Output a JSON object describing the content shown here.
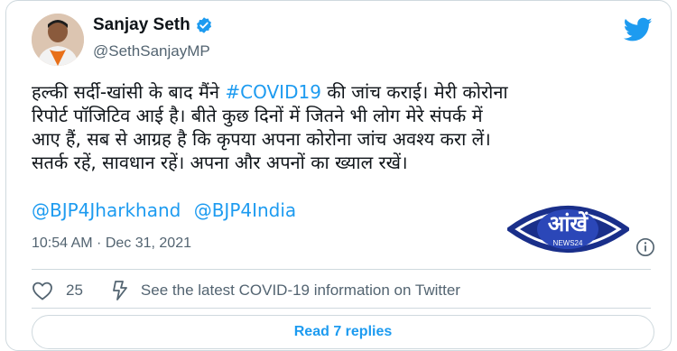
{
  "user": {
    "display_name": "Sanjay Seth",
    "handle": "@SethSanjayMP",
    "verified": true,
    "avatar_icon": "user-avatar"
  },
  "tweet": {
    "line1_before_link": "हल्की सर्दी-खांसी के बाद मैंने ",
    "hashtag": "#COVID19",
    "line1_after_link": " की जांच कराई। मेरी कोरोना",
    "line2": "रिपोर्ट पॉजिटिव आई है। बीते कुछ दिनों में जितने भी लोग मेरे संपर्क में",
    "line3": "आए हैं, सब से आग्रह है कि कृपया अपना कोरोना जांच अवश्य करा लें।",
    "line4": "सतर्क रहें, सावधान रहें। अपना और अपनों का ख्याल रखें।",
    "mentions": [
      "@BJP4Jharkhand",
      "@BJP4India"
    ],
    "timestamp": "10:54 AM · Dec 31, 2021"
  },
  "watermark": {
    "logo_text": "आंखें",
    "sub_text": "NEWS24",
    "icon": "eye-logo"
  },
  "actions": {
    "like_count": "25",
    "covid_info": "See the latest COVID-19 information on Twitter",
    "read_replies": "Read 7 replies"
  },
  "colors": {
    "link": "#1d9bf0",
    "secondary_text": "#536471",
    "border": "#cfd9de",
    "verified_badge": "#1d9bf0",
    "watermark_blue": "#1a2f8a"
  },
  "icons": [
    "twitter-bird-icon",
    "verified-badge-icon",
    "info-icon",
    "heart-icon",
    "lightning-icon"
  ]
}
